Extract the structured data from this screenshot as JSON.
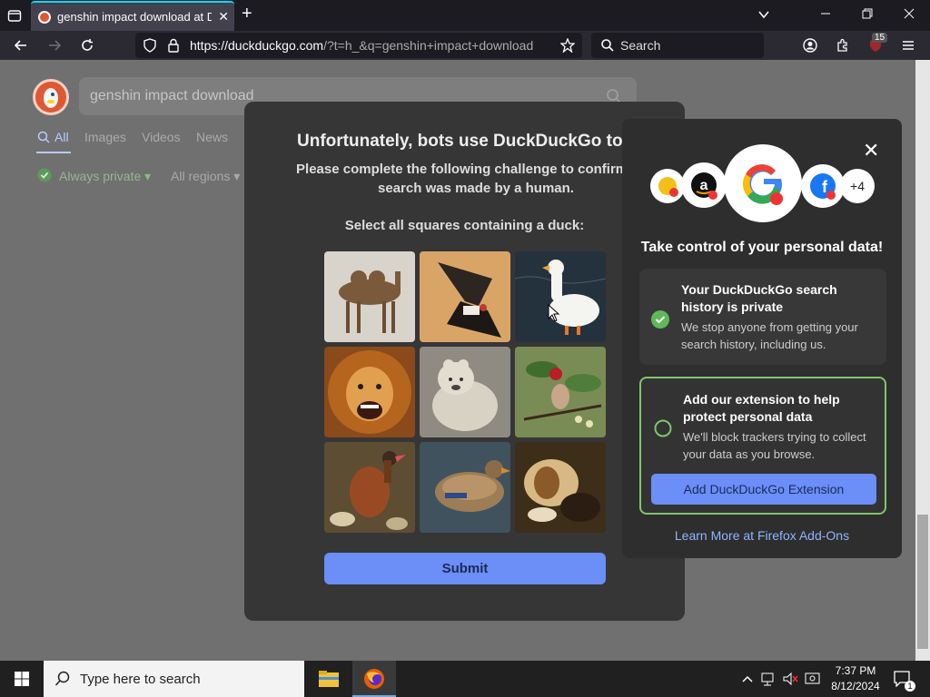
{
  "browser": {
    "tab_title": "genshin impact download at DuckDuckGo",
    "tab_close": "✕",
    "new_tab": "+",
    "url_host": "https://duckduckgo.com",
    "url_rest": "/?t=h_&q=genshin+impact+download",
    "search_placeholder": "Search",
    "extension_badge": "15"
  },
  "page": {
    "search_query": "genshin impact download",
    "tabs": [
      "All",
      "Images",
      "Videos",
      "News"
    ],
    "filter_private": "Always private",
    "filter_regions": "All regions"
  },
  "captcha": {
    "title": "Unfortunately, bots use DuckDuckGo too.",
    "subtitle": "Please complete the following challenge to confirm this search was made by a human.",
    "instruction": "Select all squares containing a duck:",
    "tiles": [
      "camel",
      "vulture",
      "white duck",
      "lion",
      "polar bear",
      "bird in branches",
      "duck on rocks",
      "mallard duck",
      "dogs painting"
    ],
    "submit_label": "Submit"
  },
  "popup": {
    "close": "✕",
    "plus_count": "+4",
    "heading": "Take control of your personal data!",
    "card1_title": "Your DuckDuckGo search history is private",
    "card1_body": "We stop anyone from getting your search history, including us.",
    "card2_title": "Add our extension to help protect personal data",
    "card2_body": "We'll block trackers trying to collect your data as you browse.",
    "add_button": "Add DuckDuckGo Extension",
    "learn_more": "Learn More at Firefox Add-Ons"
  },
  "taskbar": {
    "search_placeholder": "Type here to search",
    "time": "7:37 PM",
    "date": "8/12/2024",
    "notification_count": "1"
  },
  "colors": {
    "accent": "#6b8ef7",
    "success": "#7fc66a",
    "ddg_orange": "#de5833"
  }
}
